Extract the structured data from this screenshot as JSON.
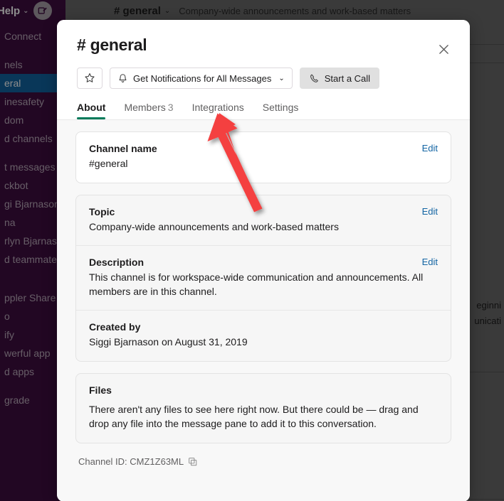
{
  "background": {
    "help_label": "Help",
    "help_caret": "⌄",
    "compose_icon": "compose-icon",
    "channel_title": "# general",
    "channel_caret": "⌄",
    "channel_topic": "Company-wide announcements and work-based matters",
    "sidebar_items": [
      {
        "label": "Connect",
        "active": false
      },
      {
        "label": "nels",
        "active": false
      },
      {
        "label": "eral",
        "active": true
      },
      {
        "label": "inesafety",
        "active": false
      },
      {
        "label": "dom",
        "active": false
      },
      {
        "label": "d channels",
        "active": false
      },
      {
        "label": "t messages",
        "active": false
      },
      {
        "label": "ckbot",
        "active": false
      },
      {
        "label": "gi Bjarnason",
        "active": false
      },
      {
        "label": "na",
        "active": false
      },
      {
        "label": "rlyn Bjarnason",
        "active": false
      },
      {
        "label": "d teammates",
        "active": false
      },
      {
        "label": "ppler Share",
        "active": false
      },
      {
        "label": "o",
        "active": false
      },
      {
        "label": "ify",
        "active": false
      },
      {
        "label": "werful app",
        "active": false
      },
      {
        "label": "d apps",
        "active": false
      },
      {
        "label": "grade",
        "active": false
      }
    ],
    "message_fragments": [
      "eginni",
      "unicati"
    ]
  },
  "modal": {
    "title": "# general",
    "close_icon": "close-icon",
    "star_icon": "star-icon",
    "notifications": {
      "bell_icon": "bell-icon",
      "label": "Get Notifications for All Messages",
      "caret": "⌄"
    },
    "start_call": {
      "phone_icon": "phone-icon",
      "label": "Start a Call"
    },
    "tabs": [
      {
        "label": "About",
        "count": "",
        "active": true
      },
      {
        "label": "Members",
        "count": "3",
        "active": false
      },
      {
        "label": "Integrations",
        "count": "",
        "active": false
      },
      {
        "label": "Settings",
        "count": "",
        "active": false
      }
    ],
    "sections": {
      "channel_name": {
        "label": "Channel name",
        "value": "#general",
        "edit": "Edit"
      },
      "topic": {
        "label": "Topic",
        "value": "Company-wide announcements and work-based matters",
        "edit": "Edit"
      },
      "description": {
        "label": "Description",
        "value": "This channel is for workspace-wide communication and announcements. All members are in this channel.",
        "edit": "Edit"
      },
      "created_by": {
        "label": "Created by",
        "value": "Siggi Bjarnason on August 31, 2019"
      },
      "files": {
        "label": "Files",
        "value": "There aren't any files to see here right now. But there could be — drag and drop any file into the message pane to add it to this conversation."
      }
    },
    "channel_id": {
      "label": "Channel ID: CMZ1Z63ML",
      "copy_icon": "copy-icon"
    }
  },
  "annotation": {
    "arrow_color": "#f43f3f",
    "points_to": "Integrations"
  },
  "colors": {
    "brand_green": "#007a5a",
    "link_blue": "#1264a3",
    "sidebar_purple": "#3f0e40",
    "sidebar_active_blue": "#1164a3"
  }
}
